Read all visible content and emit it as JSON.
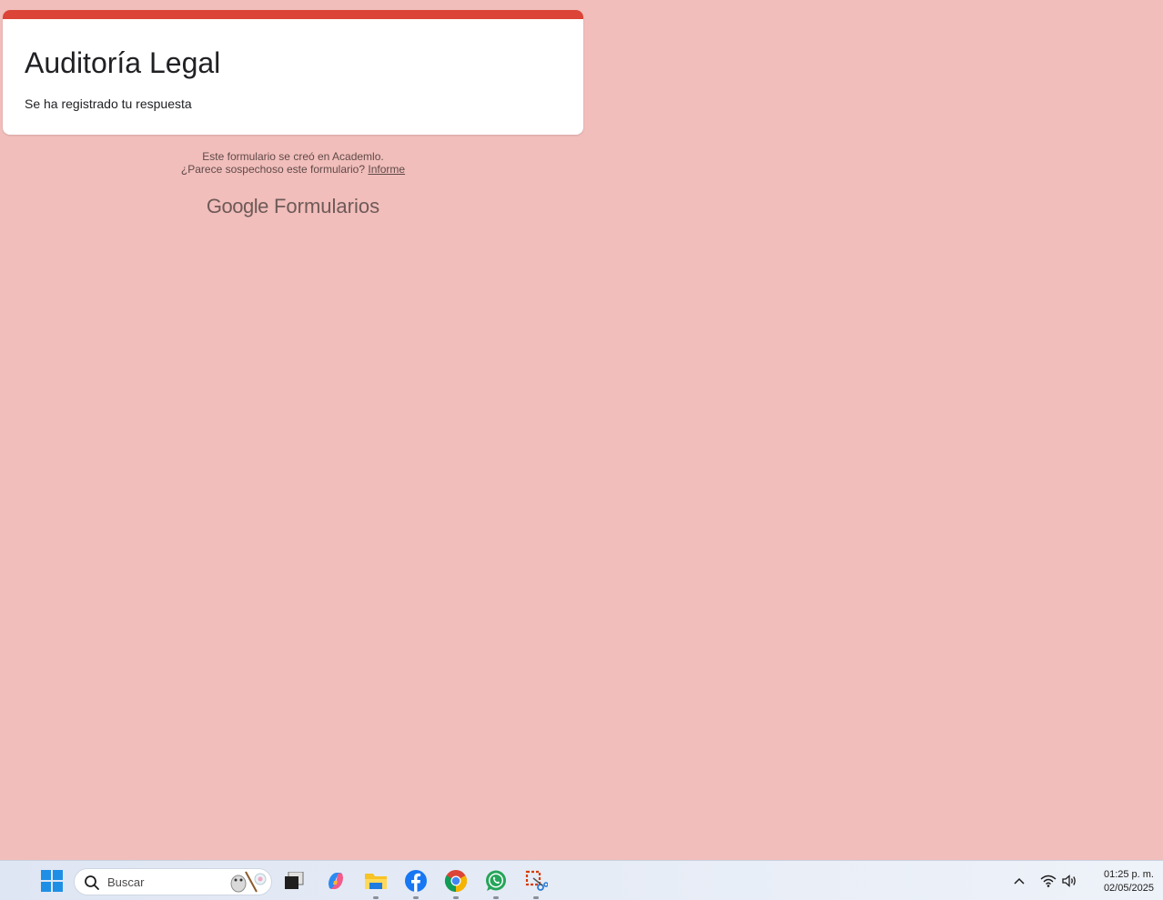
{
  "form": {
    "title": "Auditoría Legal",
    "message": "Se ha registrado tu respuesta",
    "accent_color": "#db4437"
  },
  "footer": {
    "created_in": "Este formulario se creó en Academlo.",
    "suspicious": "¿Parece sospechoso este formulario?",
    "report_link": "Informe",
    "brand_google": "Google",
    "brand_product": "Formularios"
  },
  "taskbar": {
    "search_placeholder": "Buscar",
    "apps": [
      {
        "name": "start",
        "icon": "windows-logo-icon"
      },
      {
        "name": "task-view",
        "icon": "task-view-icon"
      },
      {
        "name": "copilot",
        "icon": "copilot-icon"
      },
      {
        "name": "file-explorer",
        "icon": "folder-icon",
        "running": true
      },
      {
        "name": "facebook",
        "icon": "facebook-icon",
        "running": true
      },
      {
        "name": "chrome",
        "icon": "chrome-icon",
        "running": true
      },
      {
        "name": "whatsapp",
        "icon": "whatsapp-icon",
        "running": true
      },
      {
        "name": "snipping-tool",
        "icon": "snipping-tool-icon",
        "running": true
      }
    ],
    "time": "01:25 p. m.",
    "date": "02/05/2025"
  },
  "background_color": "#f1bebb"
}
